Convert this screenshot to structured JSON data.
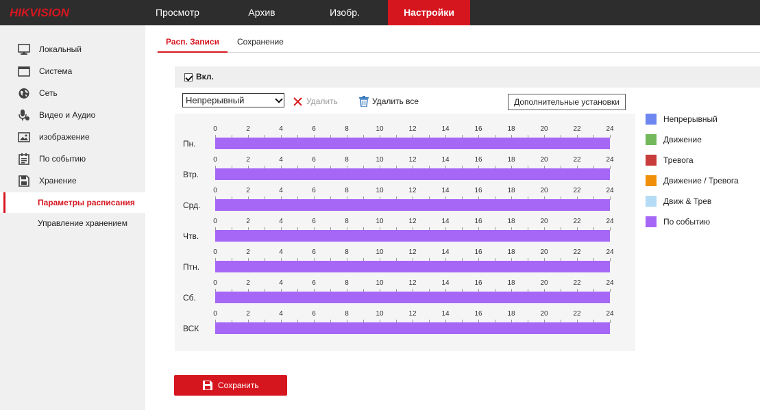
{
  "brand": "HIKVISION",
  "nav": {
    "items": [
      {
        "label": "Просмотр"
      },
      {
        "label": "Архив"
      },
      {
        "label": "Изобр."
      },
      {
        "label": "Настройки"
      }
    ]
  },
  "sidebar": {
    "items": [
      {
        "label": "Локальный",
        "icon": "monitor-icon"
      },
      {
        "label": "Система",
        "icon": "system-icon"
      },
      {
        "label": "Сеть",
        "icon": "globe-icon"
      },
      {
        "label": "Видео и Аудио",
        "icon": "mic-icon"
      },
      {
        "label": "изображение",
        "icon": "image-icon"
      },
      {
        "label": "По событию",
        "icon": "event-icon"
      },
      {
        "label": "Хранение",
        "icon": "storage-icon"
      }
    ],
    "sub": [
      {
        "label": "Параметры расписания"
      },
      {
        "label": "Управление хранением"
      }
    ]
  },
  "tabs": [
    {
      "label": "Расп. Записи"
    },
    {
      "label": "Сохранение"
    }
  ],
  "enable": {
    "label": "Вкл.",
    "checked": true
  },
  "toolbar": {
    "record_type": "Непрерывный",
    "delete_label": "Удалить",
    "delete_all_label": "Удалить все",
    "advanced_label": "Дополнительные установки"
  },
  "schedule": {
    "ticks": [
      "0",
      "2",
      "4",
      "6",
      "8",
      "10",
      "12",
      "14",
      "16",
      "18",
      "20",
      "22",
      "24"
    ],
    "days": [
      {
        "label": "Пн.",
        "start": 0,
        "end": 24,
        "type": "По событию"
      },
      {
        "label": "Втр.",
        "start": 0,
        "end": 24,
        "type": "По событию"
      },
      {
        "label": "Срд.",
        "start": 0,
        "end": 24,
        "type": "По событию"
      },
      {
        "label": "Чтв.",
        "start": 0,
        "end": 24,
        "type": "По событию"
      },
      {
        "label": "Птн.",
        "start": 0,
        "end": 24,
        "type": "По событию"
      },
      {
        "label": "Сб.",
        "start": 0,
        "end": 24,
        "type": "По событию"
      },
      {
        "label": "ВСК",
        "start": 0,
        "end": 24,
        "type": "По событию"
      }
    ]
  },
  "legend": [
    {
      "label": "Непрерывный",
      "color": "#6e86f0"
    },
    {
      "label": "Движение",
      "color": "#73b95c"
    },
    {
      "label": "Тревога",
      "color": "#c83c3c"
    },
    {
      "label": "Движение / Тревога",
      "color": "#f0900a"
    },
    {
      "label": "Движ & Трев",
      "color": "#b5dcf5"
    },
    {
      "label": "По событию",
      "color": "#a667f6"
    }
  ],
  "save_label": "Сохранить",
  "colors": {
    "accent": "#d6161f",
    "topbar": "#2d2d2d",
    "sidebar": "#f0f0f0"
  }
}
